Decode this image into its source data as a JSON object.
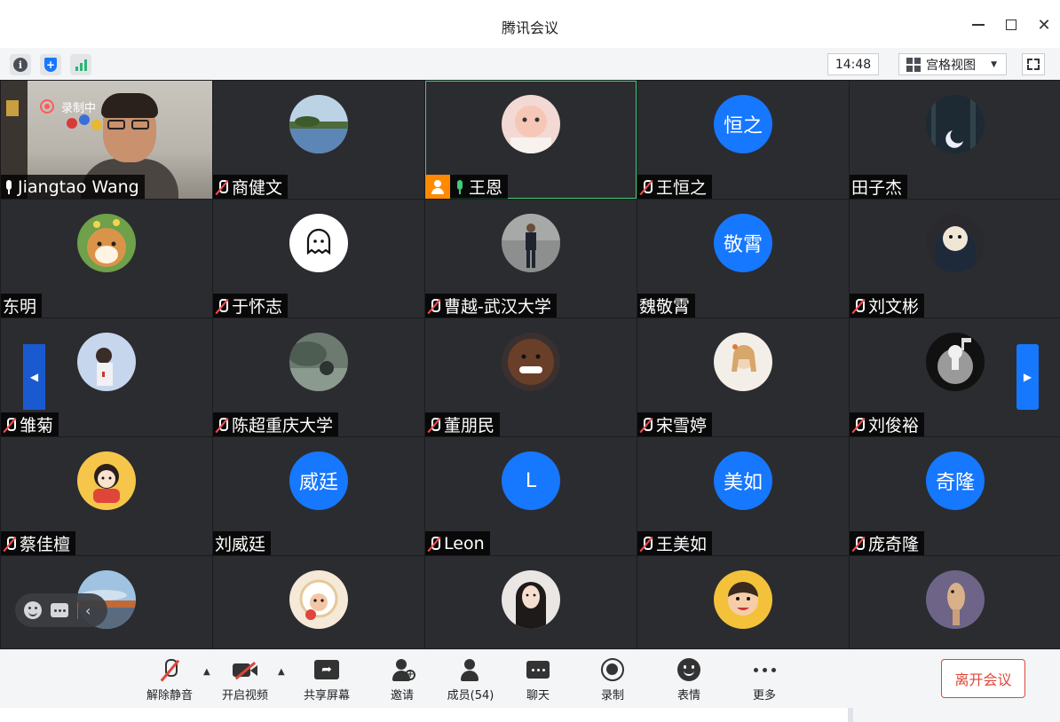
{
  "window": {
    "title": "腾讯会议"
  },
  "infobar": {
    "time": "14:48",
    "view_label": "宫格视图"
  },
  "self": {
    "name": "Jiangtao Wang",
    "recording_label": "录制中"
  },
  "tiles": [
    {
      "name": "商健文",
      "mic": "muted",
      "avatar": "photo",
      "avatar_desc": "lake"
    },
    {
      "name": "王恩",
      "mic": "on",
      "host": true,
      "active": true,
      "avatar": "photo",
      "avatar_desc": "baby"
    },
    {
      "name": "王恒之",
      "mic": "muted",
      "avatar": "text",
      "avatar_text": "恒之"
    },
    {
      "name": "田子杰",
      "mic": "none",
      "avatar": "photo",
      "avatar_desc": "moon-forest"
    },
    {
      "name": "东明",
      "mic": "none",
      "avatar": "photo",
      "avatar_desc": "shiba"
    },
    {
      "name": "于怀志",
      "mic": "muted",
      "avatar": "photo",
      "avatar_desc": "ghost"
    },
    {
      "name": "曹越-武汉大学",
      "mic": "muted",
      "avatar": "photo",
      "avatar_desc": "man-standing"
    },
    {
      "name": "魏敬霄",
      "mic": "none",
      "avatar": "text",
      "avatar_text": "敬霄"
    },
    {
      "name": "刘文彬",
      "mic": "muted",
      "avatar": "photo",
      "avatar_desc": "dog-hoodie"
    },
    {
      "name": "雏菊",
      "mic": "muted",
      "avatar": "photo",
      "avatar_desc": "boy-sky"
    },
    {
      "name": "陈超重庆大学",
      "mic": "muted",
      "avatar": "photo",
      "avatar_desc": "landscape"
    },
    {
      "name": "董朋民",
      "mic": "muted",
      "avatar": "photo",
      "avatar_desc": "smiling-man"
    },
    {
      "name": "宋雪婷",
      "mic": "muted",
      "avatar": "photo",
      "avatar_desc": "girl-drawing"
    },
    {
      "name": "刘俊裕",
      "mic": "muted",
      "avatar": "photo",
      "avatar_desc": "astronaut"
    },
    {
      "name": "蔡佳檀",
      "mic": "muted",
      "avatar": "photo",
      "avatar_desc": "cartoon-girl"
    },
    {
      "name": "刘威廷",
      "mic": "none",
      "avatar": "text",
      "avatar_text": "威廷"
    },
    {
      "name": "Leon",
      "mic": "muted",
      "avatar": "text",
      "avatar_text": "L"
    },
    {
      "name": "王美如",
      "mic": "muted",
      "avatar": "text",
      "avatar_text": "美如"
    },
    {
      "name": "庞奇隆",
      "mic": "muted",
      "avatar": "text",
      "avatar_text": "奇隆"
    },
    {
      "name": "",
      "mic": "none",
      "avatar": "photo",
      "avatar_desc": "lake-sunset"
    },
    {
      "name": "",
      "mic": "none",
      "avatar": "photo",
      "avatar_desc": "sheep-cartoon"
    },
    {
      "name": "",
      "mic": "none",
      "avatar": "photo",
      "avatar_desc": "woman-portrait"
    },
    {
      "name": "",
      "mic": "none",
      "avatar": "photo",
      "avatar_desc": "smiling-kid"
    },
    {
      "name": "",
      "mic": "none",
      "avatar": "photo",
      "avatar_desc": "animal-purple"
    }
  ],
  "toolbar": {
    "unmute": "解除静音",
    "start_video": "开启视频",
    "share_screen": "共享屏幕",
    "invite": "邀请",
    "members": "成员(54)",
    "chat": "聊天",
    "record": "录制",
    "emoji": "表情",
    "more": "更多",
    "leave": "离开会议"
  },
  "colors": {
    "accent": "#1677ff",
    "danger": "#e0453a",
    "active_border": "#3fce78",
    "host_badge": "#ff8a00"
  }
}
